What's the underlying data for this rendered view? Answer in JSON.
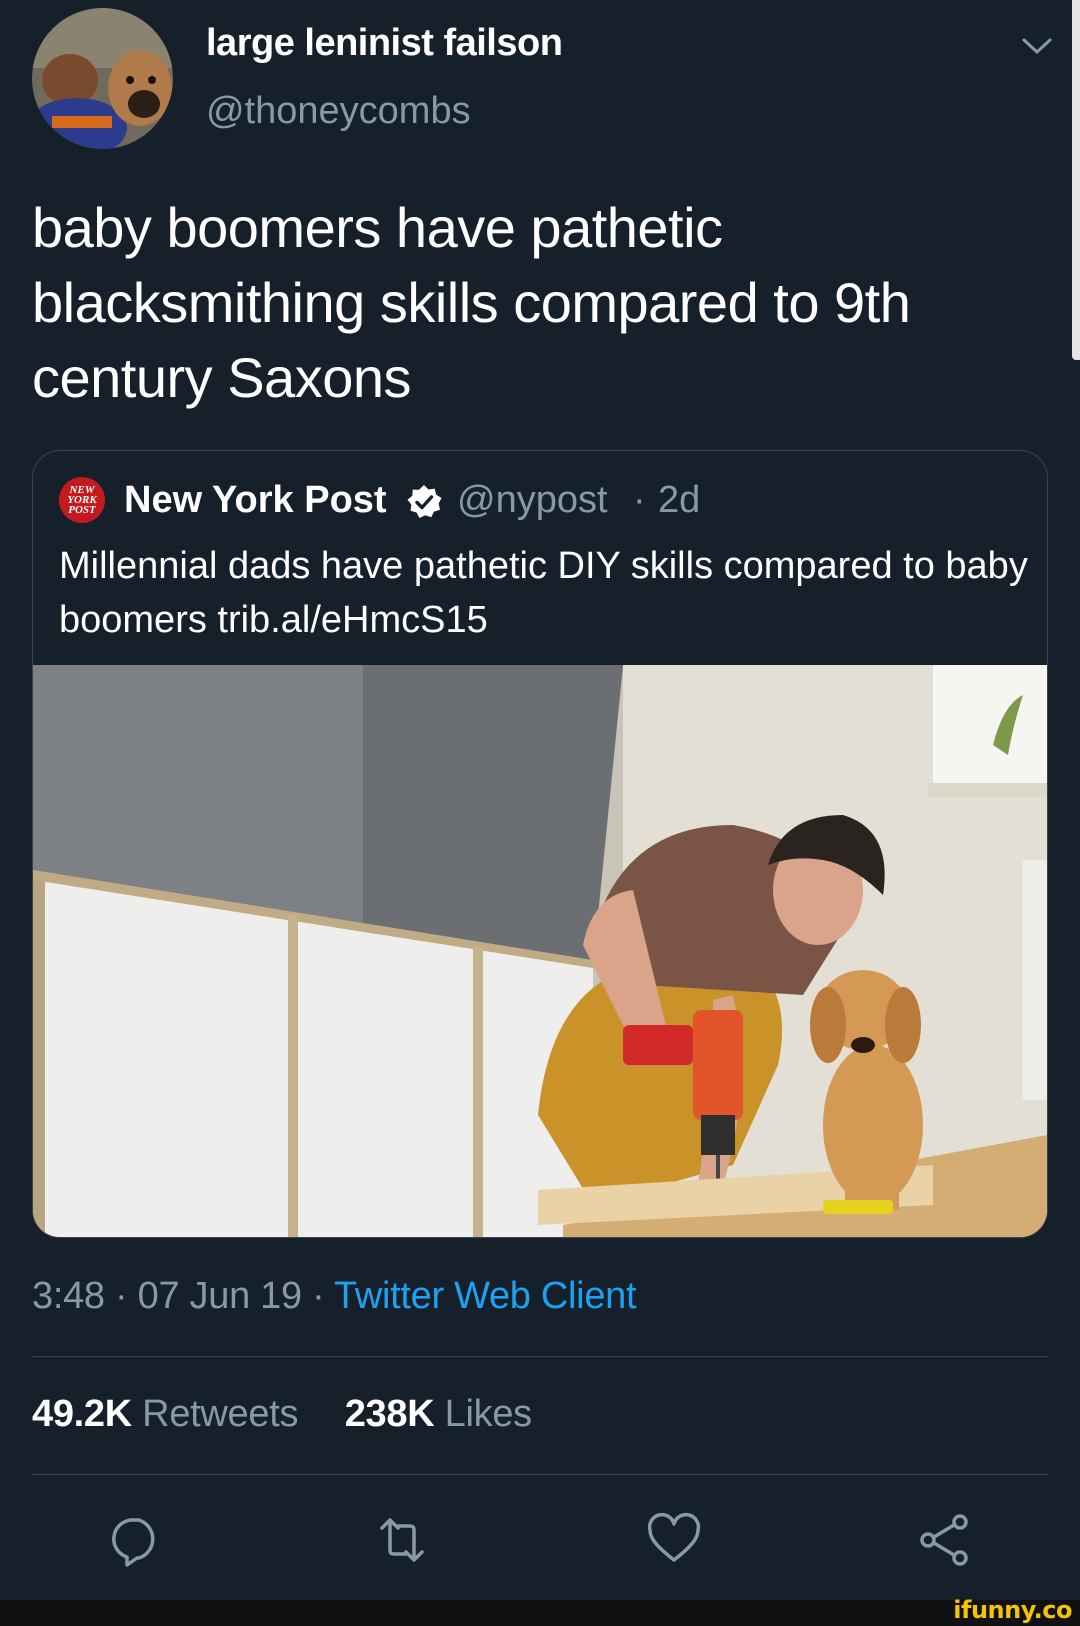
{
  "tweet": {
    "display_name": "large leninist failson",
    "handle": "@thoneycombs",
    "text": "baby boomers have pathetic blacksmithing skills compared to 9th century Saxons",
    "timestamp": "3:48 · 07 Jun 19 · ",
    "source": "Twitter Web Client",
    "retweets_count": "49.2K",
    "retweets_label": "Retweets",
    "likes_count": "238K",
    "likes_label": "Likes"
  },
  "quoted": {
    "logo_text": "NEW YORK POST",
    "name": "New York Post",
    "handle": "@nypost",
    "separator": "·",
    "time": "2d",
    "text": "Millennial dads have pathetic DIY skills compared to baby boomers trib.al/eHmcS15"
  },
  "watermark": "ifunny.co",
  "icons": {
    "menu": "chevron-down-icon",
    "verified": "verified-badge-icon",
    "reply": "reply-icon",
    "retweet": "retweet-icon",
    "like": "heart-icon",
    "share": "share-icon"
  },
  "colors": {
    "background": "#15202b",
    "secondary_text": "#8899a6",
    "link": "#1da1f2",
    "border": "#38444d",
    "watermark": "#f2c500"
  }
}
